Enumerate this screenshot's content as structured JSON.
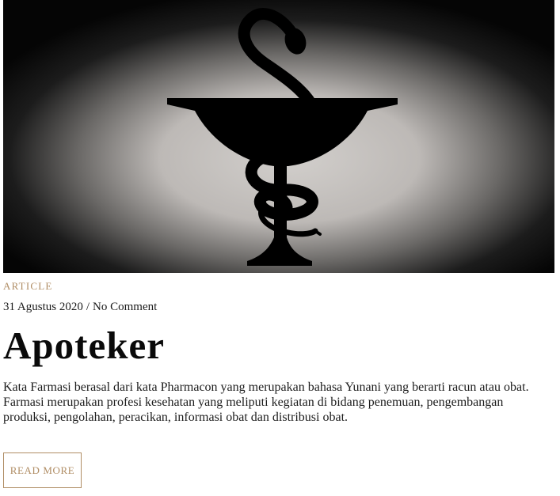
{
  "post": {
    "image_alt": "pharmacy-bowl-of-hygieia-symbol",
    "category": "ARTICLE",
    "date": "31 Agustus 2020",
    "separator": "/",
    "comments": "No Comment",
    "title": "Apoteker",
    "excerpt": "Kata Farmasi berasal dari kata Pharmacon yang merupakan bahasa Yunani yang berarti racun atau obat. Farmasi merupakan profesi kesehatan yang meliputi kegiatan di bidang penemuan, pengembangan produksi, pengolahan, peracikan, informasi obat dan distribusi obat.",
    "read_more": "READ MORE"
  },
  "colors": {
    "accent": "#b08d64",
    "text": "#111111",
    "image_glow": "#c9c6c3",
    "image_dark": "#050505"
  }
}
